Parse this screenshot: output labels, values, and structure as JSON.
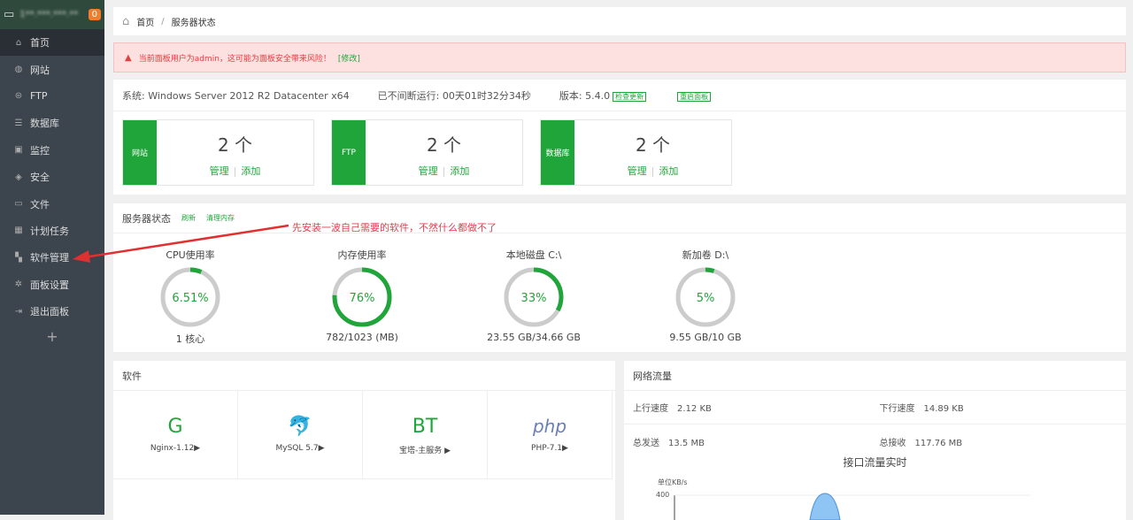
{
  "sidebar": {
    "host": "1**.***.***.**",
    "badge": "0",
    "items": [
      {
        "label": "首页",
        "icon": "home-icon"
      },
      {
        "label": "网站",
        "icon": "globe-icon"
      },
      {
        "label": "FTP",
        "icon": "ftp-icon"
      },
      {
        "label": "数据库",
        "icon": "database-icon"
      },
      {
        "label": "监控",
        "icon": "monitor-icon"
      },
      {
        "label": "安全",
        "icon": "shield-icon"
      },
      {
        "label": "文件",
        "icon": "folder-icon"
      },
      {
        "label": "计划任务",
        "icon": "calendar-icon"
      },
      {
        "label": "软件管理",
        "icon": "grid-icon"
      },
      {
        "label": "面板设置",
        "icon": "gear-icon"
      },
      {
        "label": "退出面板",
        "icon": "logout-icon"
      }
    ],
    "add": "+"
  },
  "breadcrumb": {
    "home": "首页",
    "sep": "/",
    "current": "服务器状态"
  },
  "alert": {
    "text": "当前面板用户为admin，这可能为面板安全带来风险！",
    "link": "[修改]"
  },
  "system": {
    "os": "系统: Windows Server 2012 R2 Datacenter x64",
    "uptime": "已不间断运行: 00天01时32分34秒",
    "version": "版本: 5.4.0",
    "check_update": "检查更新",
    "restart": "重启面板"
  },
  "stats": [
    {
      "label": "网站",
      "count": "2 个",
      "manage": "管理",
      "add": "添加"
    },
    {
      "label": "FTP",
      "count": "2 个",
      "manage": "管理",
      "add": "添加"
    },
    {
      "label": "数据库",
      "count": "2 个",
      "manage": "管理",
      "add": "添加"
    }
  ],
  "status": {
    "title": "服务器状态",
    "refresh": "刷新",
    "clear_mem": "清理内存",
    "gauges": [
      {
        "title": "CPU使用率",
        "value": "6.51%",
        "percent": 6.51,
        "sub": "1 核心"
      },
      {
        "title": "内存使用率",
        "value": "76%",
        "percent": 76,
        "sub": "782/1023 (MB)"
      },
      {
        "title": "本地磁盘 C:\\",
        "value": "33%",
        "percent": 33,
        "sub": "23.55 GB/34.66 GB"
      },
      {
        "title": "新加卷 D:\\",
        "value": "5%",
        "percent": 5,
        "sub": "9.55 GB/10 GB"
      }
    ]
  },
  "annotation": "先安装一波自己需要的软件，不然什么都做不了",
  "software": {
    "title": "软件",
    "items": [
      {
        "name": "Nginx-1.12▶"
      },
      {
        "name": "MySQL 5.7▶"
      },
      {
        "name": "宝塔-主服务 ▶"
      },
      {
        "name": "PHP-7.1▶"
      }
    ],
    "logos": [
      "G",
      "🐬",
      "BT",
      "php"
    ]
  },
  "network": {
    "title": "网络流量",
    "up_label": "上行速度",
    "up": "2.12 KB",
    "down_label": "下行速度",
    "down": "14.89 KB",
    "sent_label": "总发送",
    "sent": "13.5 MB",
    "recv_label": "总接收",
    "recv": "117.76 MB",
    "chart_title": "接口流量实时",
    "unit": "单位KB/s",
    "ytick": "400"
  },
  "colors": {
    "accent": "#20a53a",
    "sidebar": "#3c444d",
    "alert": "#fde0e0"
  }
}
